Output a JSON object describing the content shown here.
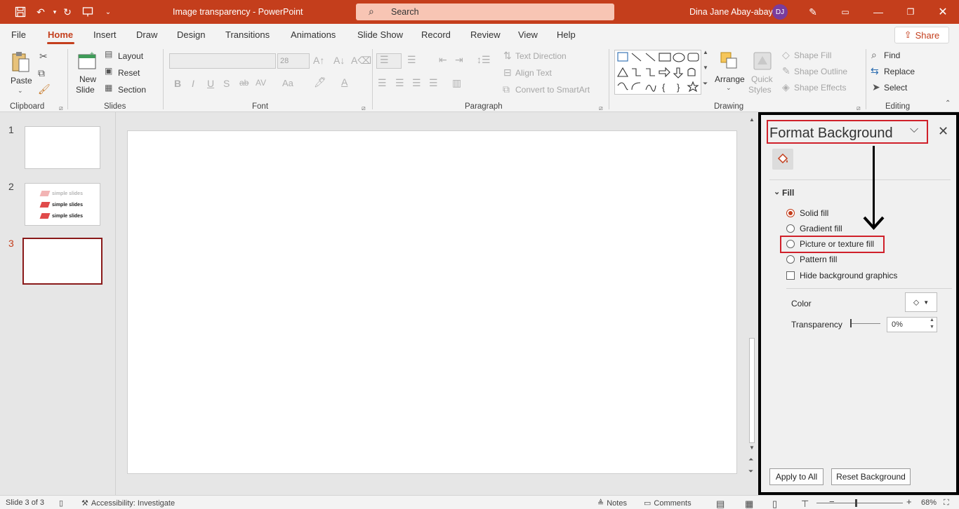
{
  "titlebar": {
    "doc_title": "Image transparency  -  PowerPoint",
    "search_placeholder": "Search",
    "user_name": "Dina Jane Abay-abay",
    "user_initials": "DJ"
  },
  "menu": {
    "tabs": [
      "File",
      "Home",
      "Insert",
      "Draw",
      "Design",
      "Transitions",
      "Animations",
      "Slide Show",
      "Record",
      "Review",
      "View",
      "Help"
    ],
    "active_tab": "Home",
    "share_label": "Share"
  },
  "ribbon": {
    "clipboard": {
      "label": "Clipboard",
      "paste": "Paste"
    },
    "slides": {
      "label": "Slides",
      "new_slide_1": "New",
      "new_slide_2": "Slide",
      "layout": "Layout",
      "reset": "Reset",
      "section": "Section"
    },
    "font": {
      "label": "Font",
      "font_size": "28"
    },
    "paragraph": {
      "label": "Paragraph",
      "text_direction": "Text Direction",
      "align_text": "Align Text",
      "convert_smartart": "Convert to SmartArt"
    },
    "drawing": {
      "label": "Drawing",
      "arrange": "Arrange",
      "quick_styles_1": "Quick",
      "quick_styles_2": "Styles",
      "shape_fill": "Shape Fill",
      "shape_outline": "Shape Outline",
      "shape_effects": "Shape Effects"
    },
    "editing": {
      "label": "Editing",
      "find": "Find",
      "replace": "Replace",
      "select": "Select"
    }
  },
  "slides_pane": {
    "numbers": [
      "1",
      "2",
      "3"
    ],
    "active_index": 3,
    "thumb2_lines": [
      "simple slides",
      "simple slides",
      "simple slides"
    ]
  },
  "format_background": {
    "title": "Format Background",
    "section": "Fill",
    "options": [
      {
        "label": "Solid fill",
        "checked": true
      },
      {
        "label": "Gradient fill",
        "checked": false
      },
      {
        "label": "Picture or texture fill",
        "checked": false
      },
      {
        "label": "Pattern fill",
        "checked": false
      }
    ],
    "hide_graphics": "Hide background graphics",
    "color_label": "Color",
    "transparency_label": "Transparency",
    "transparency_value": "0%",
    "apply_all": "Apply to All",
    "reset_background": "Reset Background"
  },
  "statusbar": {
    "slide_info": "Slide 3 of 3",
    "accessibility": "Accessibility: Investigate",
    "notes": "Notes",
    "comments": "Comments",
    "zoom": "68%"
  },
  "colors": {
    "accent": "#c43e1c",
    "highlight": "#d0202a"
  },
  "icons": [
    "save-icon",
    "undo-icon",
    "redo-icon",
    "present-icon",
    "search-icon",
    "pen-icon",
    "ribbon-display-icon",
    "minimize-icon",
    "restore-icon",
    "close-icon",
    "fill-bucket-icon"
  ]
}
